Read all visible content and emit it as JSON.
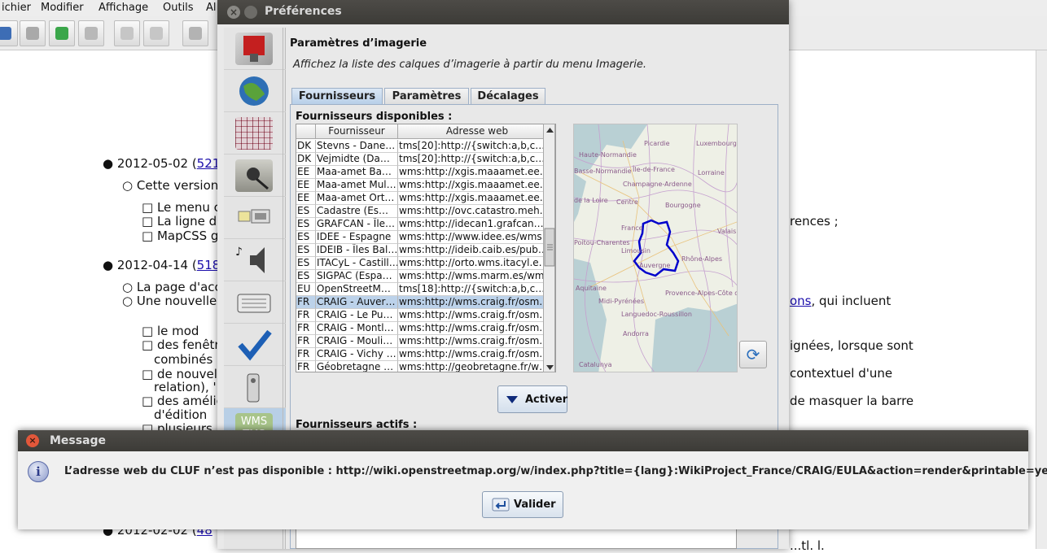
{
  "background": {
    "menu": [
      "ichier",
      "Modifier",
      "Affichage",
      "Outils",
      "Al"
    ],
    "lines": [
      {
        "bullet": "●",
        "text": "2012-05-02 (",
        "link": "521"
      },
      {
        "bullet": "○",
        "text": "Cette version"
      },
      {
        "bullet": "□",
        "text": "Le menu c"
      },
      {
        "bullet": "□",
        "text": "La ligne de"
      },
      {
        "bullet": "□",
        "text": "MapCSS g"
      },
      {
        "bullet": "●",
        "text": "2012-04-14 (",
        "link": "518"
      },
      {
        "bullet": "○",
        "text": "La page d'acc"
      },
      {
        "bullet": "○",
        "text": "Une nouvelle"
      },
      {
        "bullet": "□",
        "text": "le mod"
      },
      {
        "bullet": "□",
        "text": "des fenêtr"
      },
      {
        "bullet": "",
        "text": "combinés"
      },
      {
        "bullet": "□",
        "text": "de nouvel"
      },
      {
        "bullet": "",
        "text": "relation), '"
      },
      {
        "bullet": "□",
        "text": "des amélic"
      },
      {
        "bullet": "",
        "text": "d'édition"
      },
      {
        "bullet": "□",
        "text": "plusieurs"
      },
      {
        "bullet": "●",
        "text": "2012-02-02 (",
        "link": "48"
      }
    ],
    "right": {
      "r1": "rences ;",
      "r2_link": "ons",
      "r2_rest": ", qui incluent",
      "r3": "ignées, lorsque sont",
      "r4": "contextuel d'une",
      "r5": "de masquer la barre",
      "r6": "...tl. l."
    }
  },
  "preferences": {
    "title": "Préférences",
    "close_glyph": "×",
    "sidebar": [
      {
        "icon": "display-icon"
      },
      {
        "icon": "globe-icon"
      },
      {
        "icon": "projection-icon"
      },
      {
        "icon": "plugin-icon"
      },
      {
        "icon": "connection-icon"
      },
      {
        "icon": "audio-icon"
      },
      {
        "icon": "shortcut-icon"
      },
      {
        "icon": "validator-icon"
      },
      {
        "icon": "remote-control-icon"
      },
      {
        "icon": "wms-tms-icon",
        "label": "WMS\nTMS",
        "selected": true
      }
    ],
    "heading": "Paramètres d’imagerie",
    "description": "Affichez la liste des calques d’imagerie à partir du menu Imagerie.",
    "tabs": [
      "Fournisseurs",
      "Paramètres",
      "Décalages"
    ],
    "active_tab": 0,
    "available_label": "Fournisseurs disponibles :",
    "columns": [
      "",
      "Fournisseur",
      "Adresse web"
    ],
    "rows": [
      [
        "DK",
        "Stevns - Dane…",
        "tms[20]:http://{switch:a,b,c…"
      ],
      [
        "DK",
        "Vejmidte (Da…",
        "tms[20]:http://{switch:a,b,c…"
      ],
      [
        "EE",
        "Maa-amet Ba…",
        "wms:http://xgis.maaamet.ee…"
      ],
      [
        "EE",
        "Maa-amet Mul…",
        "wms:http://xgis.maaamet.ee…"
      ],
      [
        "EE",
        "Maa-amet Ort…",
        "wms:http://xgis.maaamet.ee…"
      ],
      [
        "ES",
        "Cadastre (Es…",
        "wms:http://ovc.catastro.meh…"
      ],
      [
        "ES",
        "GRAFCAN - Île…",
        "wms:http://idecan1.grafcan…"
      ],
      [
        "ES",
        "IDEE - Espagne",
        "wms:http://www.idee.es/wms…"
      ],
      [
        "ES",
        "IDEIB - Îles Bal…",
        "wms:http://ideib.caib.es/pub…"
      ],
      [
        "ES",
        "ITACyL - Castill…",
        "wms:http://orto.wms.itacyl.e…"
      ],
      [
        "ES",
        "SIGPAC (Espa…",
        "wms:http://wms.marm.es/wm…"
      ],
      [
        "EU",
        "OpenStreetM…",
        "tms[18]:http://{switch:a,b,c…"
      ],
      [
        "FR",
        "CRAIG - Auver…",
        "wms:http://wms.craig.fr/osm…"
      ],
      [
        "FR",
        "CRAIG - Le Pu…",
        "wms:http://wms.craig.fr/osm…"
      ],
      [
        "FR",
        "CRAIG - Montl…",
        "wms:http://wms.craig.fr/osm…"
      ],
      [
        "FR",
        "CRAIG - Mouli…",
        "wms:http://wms.craig.fr/osm…"
      ],
      [
        "FR",
        "CRAIG - Vichy …",
        "wms:http://wms.craig.fr/osm…"
      ],
      [
        "FR",
        "Géobretagne …",
        "wms:http://geobretagne.fr/w…"
      ]
    ],
    "selected_row": 12,
    "map_labels": [
      "Luxembourg",
      "Picardie",
      "Haute-Normandie",
      "Île-de-France",
      "Lorraine",
      "Basse-Normandie",
      "Champagne-Ardenne",
      "de la Loire",
      "Centre",
      "Bourgogne",
      "France",
      "Poitou-Charentes",
      "Limousin",
      "Auvergne",
      "Rhône-Alpes",
      "Midi-Pyrénées",
      "Languedoc-Roussillon",
      "Provence-Alpes-Côte d'Azur",
      "Andorra",
      "Catalunya",
      "Valais",
      "Aquitaine"
    ],
    "refresh_glyph": "⟳",
    "activate_label": "Activer",
    "active_label": "Fournisseurs actifs :"
  },
  "message": {
    "title": "Message",
    "close_glyph": "×",
    "info_glyph": "i",
    "text": "L’adresse web du CLUF n’est pas disponible : http://wiki.openstreetmap.org/w/index.php?title={lang}:WikiProject_France/CRAIG/EULA&action=render&printable=yes",
    "ok_label": "Valider"
  }
}
